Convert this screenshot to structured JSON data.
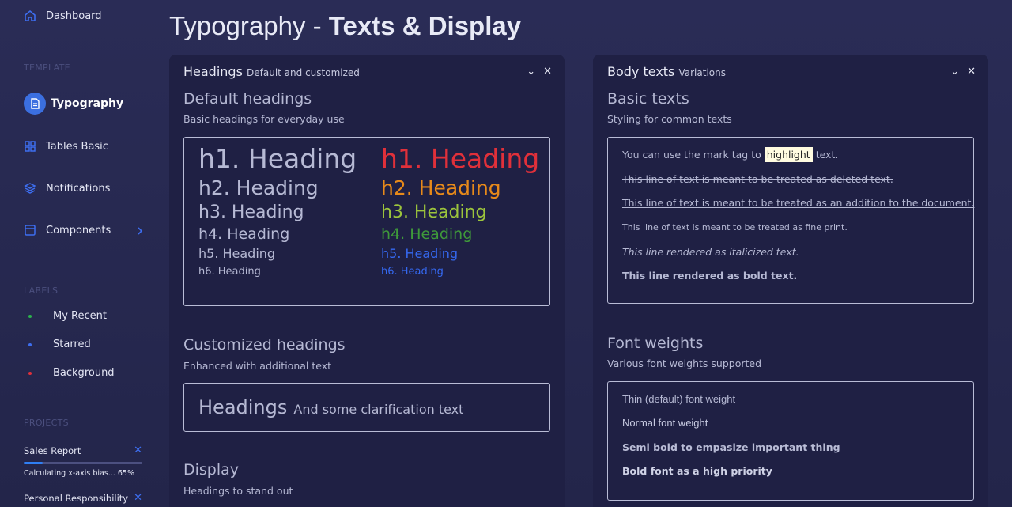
{
  "sidebar": {
    "dashboard": "Dashboard",
    "template_title": "TEMPLATE",
    "typography": "Typography",
    "tables": "Tables Basic",
    "notifications": "Notifications",
    "components": "Components",
    "labels_title": "LABELS",
    "labels": [
      {
        "label": "My Recent",
        "color": "#2bb24c"
      },
      {
        "label": "Starred",
        "color": "#3d6ef0"
      },
      {
        "label": "Background",
        "color": "#e0303a"
      }
    ],
    "projects_title": "PROJECTS",
    "projects": [
      {
        "name": "Sales Report",
        "status": "Calculating x-axis bias... 65%",
        "progress": 0.16
      },
      {
        "name": "Personal Responsibility"
      }
    ]
  },
  "page": {
    "title_light": "Typography - ",
    "title_bold": "Texts & Display"
  },
  "left_card": {
    "title": "Headings",
    "subtitle": "Default and customized",
    "default_title": "Default headings",
    "default_sub": "Basic headings for everyday use",
    "headings": [
      "h1. Heading",
      "h2. Heading",
      "h3. Heading",
      "h4. Heading",
      "h5. Heading",
      "h6. Heading"
    ],
    "heading_colors": [
      "#e0303a",
      "#e88a1a",
      "#9cc43c",
      "#3f9a3a",
      "#3568f0",
      "#3568f0"
    ],
    "custom_title": "Customized headings",
    "custom_sub": "Enhanced with additional text",
    "custom_main": "Headings",
    "custom_clar": "And some clarification text",
    "display_title": "Display",
    "display_sub": "Headings to stand out"
  },
  "right_card": {
    "title": "Body texts",
    "subtitle": "Variations",
    "basic_title": "Basic texts",
    "basic_sub": "Styling for common texts",
    "mark_pre": "You can use the mark tag to",
    "mark_word": "highlight",
    "mark_post": "text.",
    "deleted": "This line of text is meant to be treated as deleted text.",
    "addition": "This line of text is meant to be treated as an addition to the document.",
    "fine": "This line of text is meant to be treated as fine print.",
    "italic": "This line rendered as italicized text.",
    "bold": "This line rendered as bold text.",
    "weights_title": "Font weights",
    "weights_sub": "Various font weights supported",
    "w_thin": "Thin (default) font weight",
    "w_normal": "Normal font weight",
    "w_semibold": "Semi bold to empasize important thing",
    "w_bold": "Bold font as a high priority"
  }
}
